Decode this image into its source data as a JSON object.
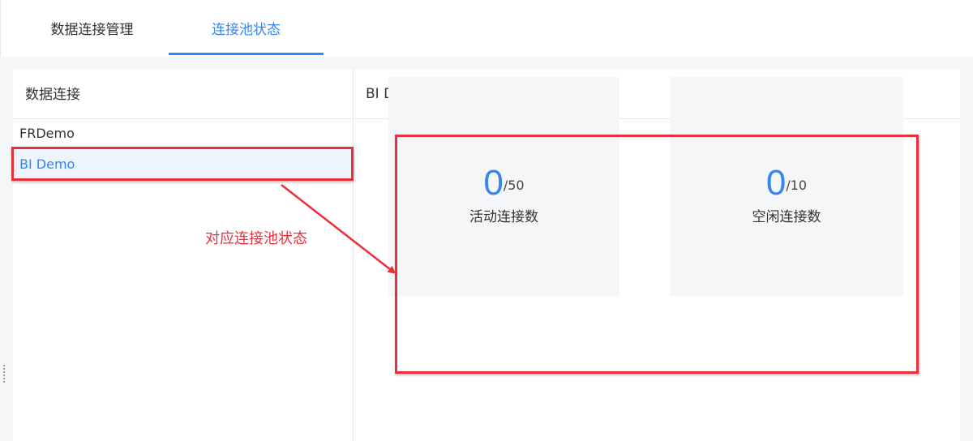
{
  "tabs": [
    {
      "label": "数据连接管理"
    },
    {
      "label": "连接池状态"
    }
  ],
  "left_panel": {
    "header": "数据连接",
    "items": [
      {
        "label": "FRDemo"
      },
      {
        "label": "BI Demo"
      }
    ]
  },
  "right_panel": {
    "header": "BI Demo",
    "stats": [
      {
        "value": "0",
        "max": "/50",
        "label": "活动连接数"
      },
      {
        "value": "0",
        "max": "/10",
        "label": "空闲连接数"
      }
    ]
  },
  "annotation": {
    "text": "对应连接池状态",
    "color": "#e8303b"
  },
  "colors": {
    "accent": "#3685f2",
    "selected_bg": "#eef4fd"
  }
}
